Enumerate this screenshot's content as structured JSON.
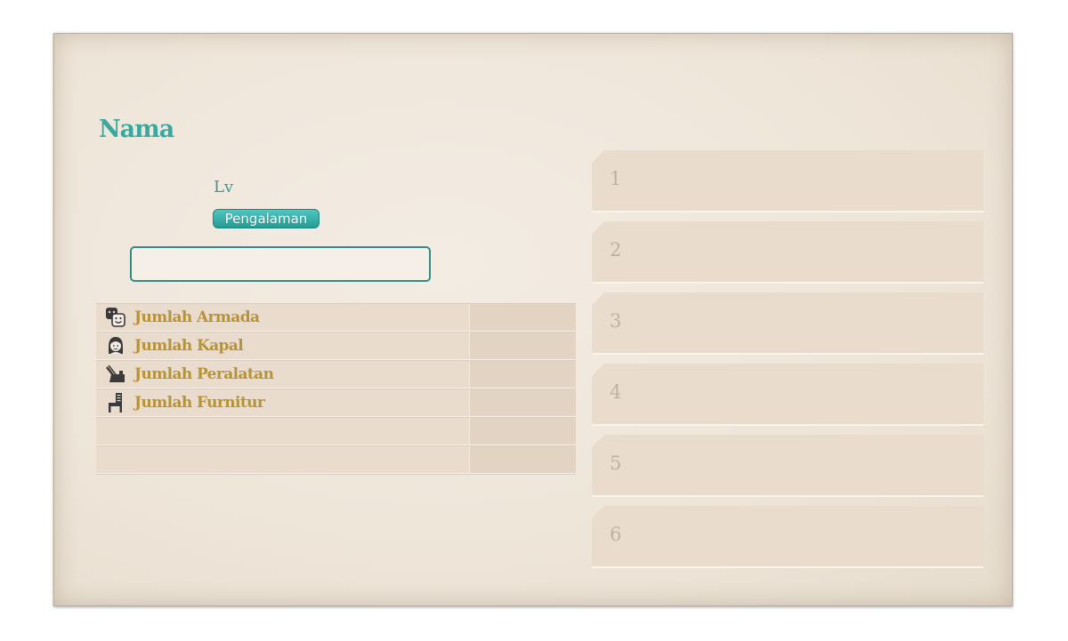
{
  "profile": {
    "name_label": "Nama",
    "level_label": "Lv",
    "exp_label": "Pengalaman",
    "name_input_value": ""
  },
  "stats": {
    "rows": [
      {
        "label": "Jumlah Armada",
        "icon": "fleet-face-icon",
        "value": ""
      },
      {
        "label": "Jumlah Kapal",
        "icon": "shipgirl-icon",
        "value": ""
      },
      {
        "label": "Jumlah Peralatan",
        "icon": "equipment-icon",
        "value": ""
      },
      {
        "label": "Jumlah Furnitur",
        "icon": "chair-icon",
        "value": ""
      },
      {
        "label": "",
        "icon": "",
        "value": ""
      },
      {
        "label": "",
        "icon": "",
        "value": ""
      }
    ]
  },
  "slots": [
    {
      "number": "1"
    },
    {
      "number": "2"
    },
    {
      "number": "3"
    },
    {
      "number": "4"
    },
    {
      "number": "5"
    },
    {
      "number": "6"
    }
  ],
  "colors": {
    "teal_accent": "#3aa8a0",
    "gold_text": "#b69336",
    "slot_number": "#bfb1a2"
  }
}
